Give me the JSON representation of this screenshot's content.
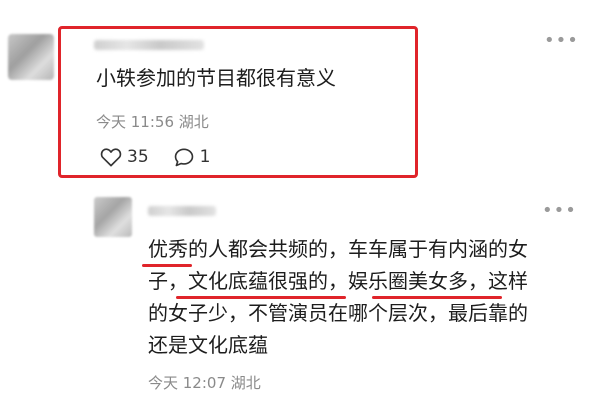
{
  "top_comment": {
    "text": "小轶参加的节目都很有意义",
    "meta": "今天 11:56 湖北",
    "likes": "35",
    "replies": "1",
    "icons": [
      "heart-outline-icon",
      "comment-bubble-icon",
      "more-options-icon"
    ]
  },
  "reply_comment": {
    "lines": [
      "优秀的人都会共频的，车车属于有内涵的女",
      "子，文化底蕴很强的，娱乐圈美女多，这样",
      "的女子少，不管演员在哪个层次，最后靠的",
      "还是文化底蕴"
    ],
    "meta": "今天 12:07 湖北"
  },
  "highlight_color": "#e0242a"
}
